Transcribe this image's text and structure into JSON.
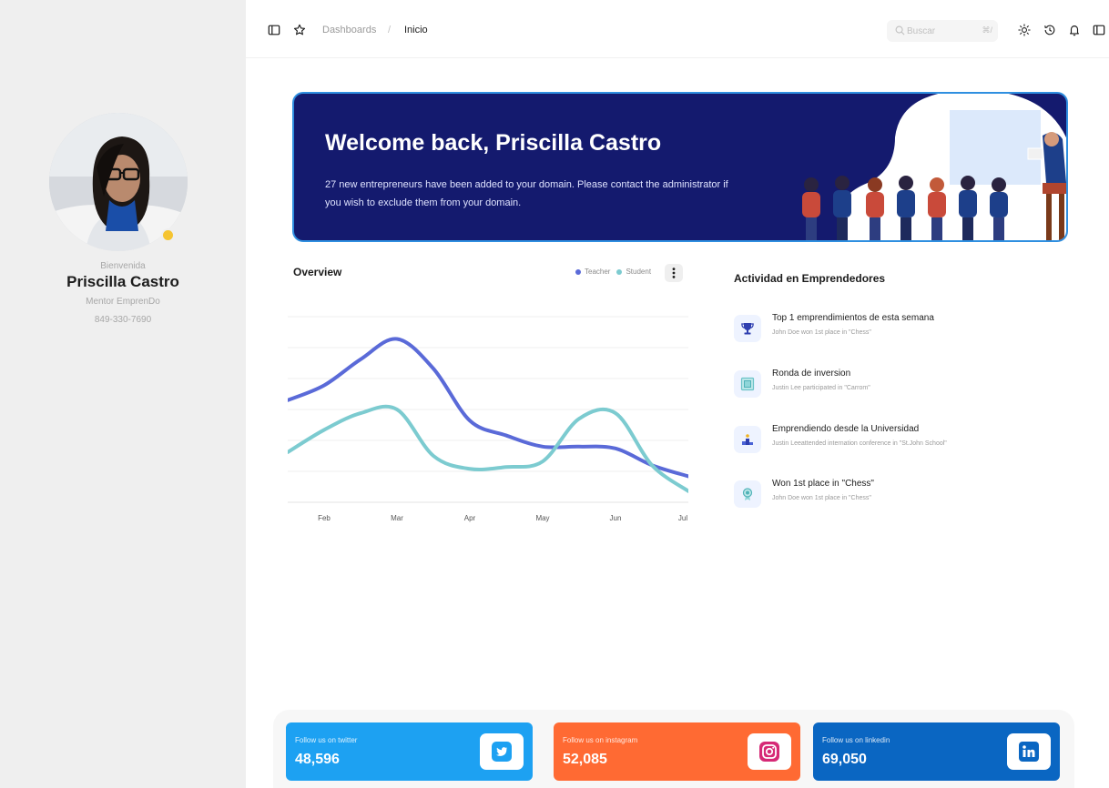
{
  "profile": {
    "greeting": "Bienvenida",
    "name": "Priscilla Castro",
    "role": "Mentor EmprenDo",
    "phone": "849-330-7690",
    "status_color": "#f5c431"
  },
  "topbar": {
    "breadcrumb": [
      "Dashboards",
      "Inicio"
    ],
    "breadcrumb_separator": "/",
    "search_placeholder": "Buscar",
    "search_shortcut": "⌘/"
  },
  "banner": {
    "title": "Welcome back, Priscilla Castro",
    "text": "27 new entrepreneurs have been added to your domain. Please contact the administrator if you wish to exclude them from your domain.",
    "background_color": "#141a6e",
    "border_color": "#2f8fe0"
  },
  "overview": {
    "title": "Overview",
    "legend": [
      "Teacher",
      "Student"
    ]
  },
  "chart_data": {
    "type": "line",
    "categories": [
      "Feb",
      "Mar",
      "Apr",
      "May",
      "Jun",
      "Jul"
    ],
    "x": [
      0.5,
      1,
      1.5,
      2,
      2.5,
      3,
      3.5,
      4,
      4.5,
      5,
      5.5,
      6
    ],
    "ylim": [
      0,
      100
    ],
    "grid": true,
    "legend_position": "top-right",
    "series": [
      {
        "name": "Teacher",
        "color": "#5a6ad8",
        "values": [
          55,
          63,
          77,
          88,
          72,
          44,
          36,
          30,
          30,
          29,
          20,
          14
        ]
      },
      {
        "name": "Student",
        "color": "#7ccbd0",
        "values": [
          27,
          39,
          48,
          50,
          25,
          18,
          19,
          22,
          45,
          48,
          20,
          6
        ]
      }
    ]
  },
  "activity": {
    "title": "Actividad en Emprendedores",
    "items": [
      {
        "icon": "trophy-icon",
        "title": "Top 1 emprendimientos de esta semana",
        "desc": "John Doe won 1st place in \"Chess\""
      },
      {
        "icon": "frame-icon",
        "title": "Ronda de inversion",
        "desc": "Justin Lee participated in \"Carrom\""
      },
      {
        "icon": "podium-icon",
        "title": "Emprendiendo desde la Universidad",
        "desc": "Justin Leeattended internation conference in \"St.John School\""
      },
      {
        "icon": "medal-icon",
        "title": "Won 1st place in \"Chess\"",
        "desc": "John Doe won 1st place in \"Chess\""
      }
    ]
  },
  "social": [
    {
      "network": "twitter",
      "label": "Follow us on twitter",
      "count": "48,596",
      "color": "#1da1f2",
      "icon": "twitter-icon"
    },
    {
      "network": "instagram",
      "label": "Follow us on instagram",
      "count": "52,085",
      "color": "#ff6a33",
      "icon": "instagram-icon"
    },
    {
      "network": "linkedin",
      "label": "Follow us on linkedin",
      "count": "69,050",
      "color": "#0a66c2",
      "icon": "linkedin-icon"
    }
  ]
}
